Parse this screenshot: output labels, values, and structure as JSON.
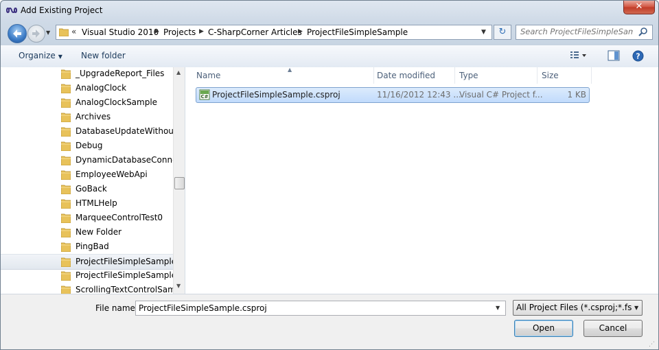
{
  "window": {
    "title": "Add Existing Project",
    "close_glyph": "✕"
  },
  "nav": {
    "breadcrumbs": [
      "Visual Studio 2010",
      "Projects",
      "C-SharpCorner Articles",
      "ProjectFileSimpleSample"
    ],
    "overflow_glyph": "«",
    "refresh_glyph": "↻",
    "search_placeholder": "Search ProjectFileSimpleSample"
  },
  "toolbar": {
    "organize": "Organize",
    "new_folder": "New folder"
  },
  "tree": {
    "items": [
      "_UpgradeReport_Files",
      "AnalogClock",
      "AnalogClockSample",
      "Archives",
      "DatabaseUpdateWithoutCo",
      "Debug",
      "DynamicDatabaseConnect",
      "EmployeeWebApi",
      "GoBack",
      "HTMLHelp",
      "MarqueeControlTest0",
      "New Folder",
      "PingBad",
      "ProjectFileSimpleSample",
      "ProjectFileSimpleSampleIn",
      "ScrollingTextControlSampl"
    ],
    "selected": "ProjectFileSimpleSample"
  },
  "columns": {
    "name": "Name",
    "date": "Date modified",
    "type": "Type",
    "size": "Size"
  },
  "files": [
    {
      "name": "ProjectFileSimpleSample.csproj",
      "date": "11/16/2012 12:43 ...",
      "type": "Visual C# Project f...",
      "size": "1 KB"
    }
  ],
  "footer": {
    "file_name_label": "File name:",
    "file_name_value": "ProjectFileSimpleSample.csproj",
    "file_type": "All Project Files (*.csproj;*.fspro",
    "open": "Open",
    "cancel": "Cancel"
  },
  "colors": {
    "selection": "#c1dbfc",
    "selection_border": "#7da2ce",
    "folder": "#e8c25a",
    "close": "#c94631"
  }
}
